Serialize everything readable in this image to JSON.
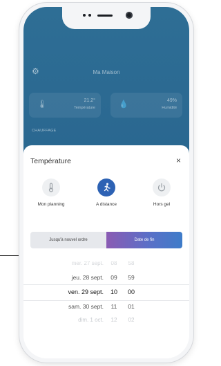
{
  "dashboard": {
    "home_title": "Ma Maison",
    "temperature_card": {
      "value": "21.2°",
      "label": "Température"
    },
    "humidity_card": {
      "value": "49%",
      "label": "Humidité"
    },
    "section_label": "CHAUFFAGE"
  },
  "sheet": {
    "title": "Température",
    "close_glyph": "×",
    "modes": [
      {
        "label": "Mon planning",
        "icon": "thermometer-icon"
      },
      {
        "label": "A distance",
        "icon": "running-person-icon",
        "active": true
      },
      {
        "label": "Hors gel",
        "icon": "power-icon"
      }
    ],
    "toggle": {
      "left_label": "Jusqu'à nouvel ordre",
      "right_label": "Date de fin",
      "selected": "right"
    },
    "picker": {
      "rows": [
        {
          "date": "mer. 27 sept.",
          "hour": "08",
          "minute": "58"
        },
        {
          "date": "jeu. 28 sept.",
          "hour": "09",
          "minute": "59"
        },
        {
          "date": "ven. 29 sept.",
          "hour": "10",
          "minute": "00"
        },
        {
          "date": "sam. 30 sept.",
          "hour": "11",
          "minute": "01"
        },
        {
          "date": "dim. 1 oct.",
          "hour": "12",
          "minute": "02"
        }
      ],
      "selected_index": 2
    }
  },
  "colors": {
    "header_blue": "#2e6e95",
    "accent_blue": "#2d62b4",
    "gradient_start": "#8a5bb3",
    "gradient_end": "#3e7cc9"
  }
}
